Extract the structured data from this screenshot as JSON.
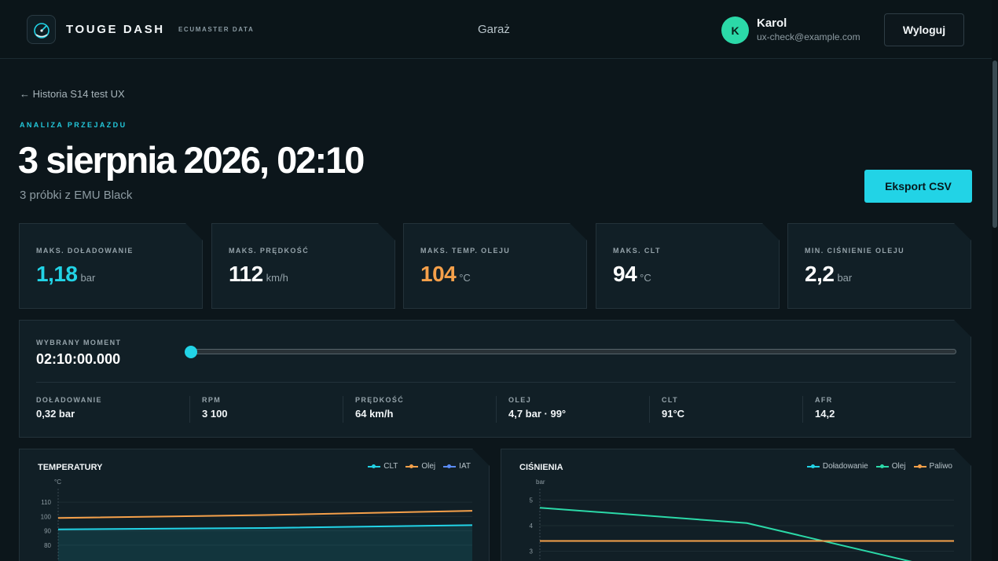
{
  "header": {
    "brand": "TOUGE DASH",
    "brand_sub": "ECUMASTER DATA",
    "nav_garage": "Garaż",
    "user": {
      "initial": "K",
      "name": "Karol",
      "email": "ux-check@example.com"
    },
    "logout_label": "Wyloguj"
  },
  "page": {
    "back_link": "← Historia S14 test UX",
    "eyebrow": "ANALIZA PRZEJAZDU",
    "title": "3 sierpnia 2026, 02:10",
    "subtitle": "3 próbki z EMU Black",
    "export_label": "Eksport CSV"
  },
  "stats": [
    {
      "label": "MAKS. DOŁADOWANIE",
      "value": "1,18",
      "unit": "bar",
      "color": "#22d3e6"
    },
    {
      "label": "MAKS. PRĘDKOŚĆ",
      "value": "112",
      "unit": "km/h",
      "color": "#ffffff"
    },
    {
      "label": "MAKS. TEMP. OLEJU",
      "value": "104",
      "unit": "°C",
      "color": "#f5a04a"
    },
    {
      "label": "MAKS. CLT",
      "value": "94",
      "unit": "°C",
      "color": "#ffffff"
    },
    {
      "label": "MIN. CIŚNIENIE OLEJU",
      "value": "2,2",
      "unit": "bar",
      "color": "#ffffff"
    }
  ],
  "moment": {
    "label": "WYBRANY MOMENT",
    "time": "02:10:00.000",
    "slider_fraction": 0,
    "metrics": [
      {
        "label": "DOŁADOWANIE",
        "value": "0,32 bar"
      },
      {
        "label": "RPM",
        "value": "3 100"
      },
      {
        "label": "PRĘDKOŚĆ",
        "value": "64 km/h"
      },
      {
        "label": "OLEJ",
        "value": "4,7 bar · 99°"
      },
      {
        "label": "CLT",
        "value": "91°C"
      },
      {
        "label": "AFR",
        "value": "14,2"
      }
    ]
  },
  "chart_data": [
    {
      "type": "line",
      "title": "TEMPERATURY",
      "ylabel": "°C",
      "ylim": [
        75,
        115
      ],
      "yticks": [
        110,
        100,
        90,
        80
      ],
      "x": [
        0,
        1,
        2
      ],
      "series": [
        {
          "name": "CLT",
          "values": [
            91,
            92,
            94
          ],
          "color": "#22d3e6",
          "fill": true
        },
        {
          "name": "Olej",
          "values": [
            99,
            101,
            104
          ],
          "color": "#f5a04a"
        },
        {
          "name": "IAT",
          "values": [],
          "color": "#5b8cf5"
        }
      ]
    },
    {
      "type": "line",
      "title": "CIŚNIENIA",
      "ylabel": "bar",
      "ylim": [
        2.8,
        5.2
      ],
      "yticks": [
        5,
        4,
        3
      ],
      "x": [
        0,
        1,
        2
      ],
      "series": [
        {
          "name": "Doładowanie",
          "values": [],
          "color": "#22d3e6"
        },
        {
          "name": "Olej",
          "values": [
            4.7,
            4.1,
            2.2
          ],
          "color": "#2bd9a8"
        },
        {
          "name": "Paliwo",
          "values": [
            3.4,
            3.4,
            3.4
          ],
          "color": "#f5a04a"
        }
      ]
    }
  ]
}
